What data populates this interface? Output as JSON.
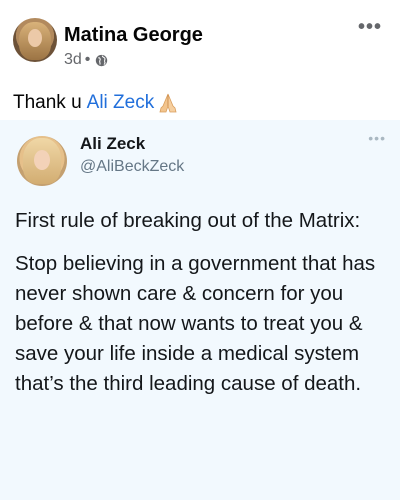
{
  "post": {
    "author_name": "Matina George",
    "time": "3d",
    "separator": "•",
    "privacy_icon": "globe-icon",
    "more_icon": "•••",
    "text_prefix": "Thank u",
    "mention": "Ali Zeck",
    "emoji": "folded-hands-emoji"
  },
  "shared_tweet": {
    "name": "Ali Zeck",
    "handle": "@AliBeckZeck",
    "more_icon": "•••",
    "paragraph_1": "First rule of breaking out of the Matrix:",
    "paragraph_2": "Stop believing in a government that has never shown care & concern for you before & that now wants to treat you & save your life inside a medical system that’s the third leading cause of death."
  },
  "colors": {
    "mention": "#216fdb",
    "card_background": "#f2f9fe",
    "meta_text": "#65676b"
  }
}
